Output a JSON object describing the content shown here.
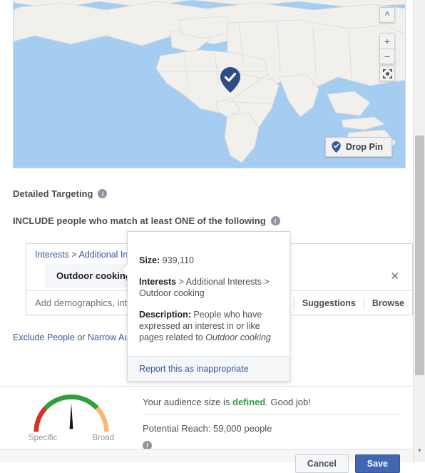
{
  "map": {
    "pin_icon": "map-pin-check-icon",
    "controls": {
      "compass_icon": "chevron-up-icon",
      "zoom_in_label": "+",
      "zoom_out_label": "−",
      "fullscreen_icon": "fullscreen-icon"
    },
    "drop_pin": {
      "icon": "map-pin-icon",
      "label": "Drop Pin"
    },
    "water_color": "#a5cdf2",
    "land_color": "#f2f0ed",
    "pin_color": "#2c4d88"
  },
  "detailed_targeting": {
    "title": "Detailed Targeting",
    "info_icon": "info-icon",
    "include_text": "INCLUDE people who match at least ONE of the following",
    "include_info_icon": "info-icon",
    "breadcrumb": {
      "root": "Interests",
      "separator": ">",
      "child": "Additional Interests"
    },
    "selected_interest": "Outdoor cooking",
    "remove_icon": "close-icon",
    "add_placeholder": "Add demographics, interests",
    "suggestions_label": "Suggestions",
    "browse_label": "Browse",
    "exclude_label": "Exclude People",
    "or_label": "or",
    "narrow_label": "Narrow Audience"
  },
  "popover": {
    "size_label": "Size:",
    "size_value": "939,110",
    "interests_label": "Interests",
    "interests_path": "> Additional Interests > Outdoor cooking",
    "description_label": "Description:",
    "description_value": "People who have expressed an interest in or like pages related to",
    "description_emphasis": "Outdoor cooking",
    "report_link": "Report this as inappropriate"
  },
  "audience": {
    "gauge": {
      "left_label": "Specific",
      "right_label": "Broad",
      "red_color": "#d93025",
      "green_color": "#2e9e3e",
      "orange_color": "#f5b971",
      "needle_position": "center"
    },
    "status_prefix": "Your audience size is",
    "status_value": "defined",
    "status_suffix": ". Good job!",
    "reach_text": "Potential Reach: 59,000 people",
    "reach_info_icon": "info-icon"
  },
  "actions": {
    "cancel_label": "Cancel",
    "save_label": "Save",
    "save_color": "#4267b2"
  },
  "scrollbar": {
    "down_arrow_icon": "chevron-down-icon"
  }
}
